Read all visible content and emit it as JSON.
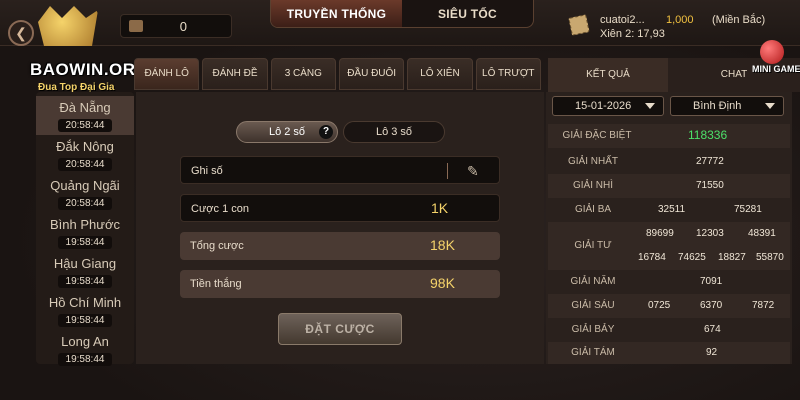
{
  "topbar": {
    "balance": "0",
    "modes": [
      "TRUYỀN THỐNG",
      "SIÊU TỐC"
    ],
    "user": {
      "name": "cuatoi2...",
      "coins": "1,000",
      "region": "(Miền Bắc)",
      "xien": "Xiên 2: 17,93"
    }
  },
  "logo": {
    "brand": "BAOWIN.ORG",
    "slogan": "Đua Top Đại Gia"
  },
  "provinces": [
    {
      "name": "Đà Nẵng",
      "time": "20:58:44"
    },
    {
      "name": "Đắk Nông",
      "time": "20:58:44"
    },
    {
      "name": "Quảng Ngãi",
      "time": "20:58:44"
    },
    {
      "name": "Bình Phước",
      "time": "19:58:44"
    },
    {
      "name": "Hậu Giang",
      "time": "19:58:44"
    },
    {
      "name": "Hồ Chí Minh",
      "time": "19:58:44"
    },
    {
      "name": "Long An",
      "time": "19:58:44"
    }
  ],
  "tabs": [
    "ĐÁNH LÔ",
    "ĐÁNH ĐỀ",
    "3 CÀNG",
    "ĐẦU ĐUÔI",
    "LÔ XIÊN",
    "LÔ TRƯỢT"
  ],
  "bet": {
    "mode_lo2": "Lô 2 số",
    "mode_lo3": "Lô 3 số",
    "note_label": "Ghi số",
    "bet_label": "Cược 1 con",
    "bet_value": "1K",
    "total_label": "Tổng cược",
    "total_value": "18K",
    "win_label": "Tiền thắng",
    "win_value": "98K",
    "place_label": "ĐẶT CƯỢC"
  },
  "results": {
    "tab_result": "KẾT QUẢ",
    "tab_chat": "CHAT",
    "minigame": "MINI GAME",
    "date": "15-01-2026",
    "province": "Bình Định",
    "special_label": "GIẢI ĐẶC BIỆT",
    "special": "118336",
    "first_label": "GIẢI NHẤT",
    "first": "27772",
    "second_label": "GIẢI NHÌ",
    "second": "71550",
    "third_label": "GIẢI BA",
    "third": [
      "32511",
      "75281"
    ],
    "fourth_label": "GIẢI TƯ",
    "fourth": [
      "89699",
      "12303",
      "48391",
      "16784",
      "74625",
      "18827",
      "55870"
    ],
    "fifth_label": "GIẢI NĂM",
    "fifth": "7091",
    "sixth_label": "GIẢI SÁU",
    "sixth": [
      "0725",
      "6370",
      "7872"
    ],
    "seventh_label": "GIẢI BẢY",
    "seventh": "674",
    "eighth_label": "GIẢI TÁM",
    "eighth": "92"
  }
}
